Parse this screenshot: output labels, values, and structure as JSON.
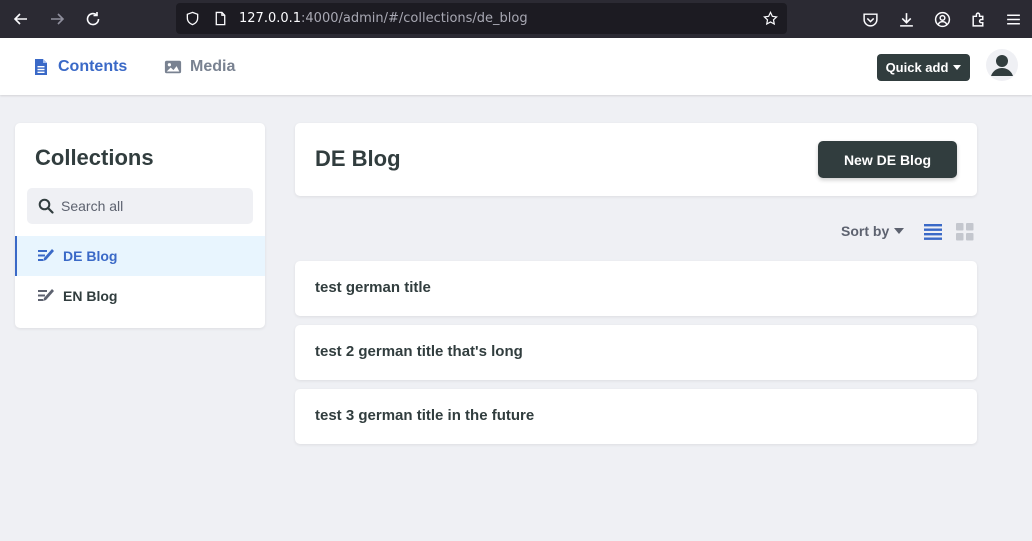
{
  "browser": {
    "url_host": "127.0.0.1",
    "url_rest": ":4000/admin/#/collections/de_blog",
    "icons": [
      "back-icon",
      "forward-icon",
      "reload-icon",
      "shield-icon",
      "page-icon",
      "bookmark-star-icon",
      "pocket-icon",
      "download-icon",
      "account-icon",
      "extensions-icon",
      "menu-icon"
    ]
  },
  "header": {
    "tabs": [
      {
        "label": "Contents",
        "icon": "document-icon",
        "active": true
      },
      {
        "label": "Media",
        "icon": "image-icon",
        "active": false
      }
    ],
    "quick_add_label": "Quick add"
  },
  "sidebar": {
    "title": "Collections",
    "search_placeholder": "Search all",
    "items": [
      {
        "label": "DE Blog",
        "icon": "edit-list-icon",
        "active": true
      },
      {
        "label": "EN Blog",
        "icon": "edit-list-icon",
        "active": false
      }
    ]
  },
  "main": {
    "title": "DE Blog",
    "new_button_label": "New DE Blog",
    "sort_label": "Sort by",
    "view_modes": [
      "list",
      "grid"
    ],
    "active_view": "list",
    "entries": [
      {
        "title": "test german title"
      },
      {
        "title": "test 2 german title that's long"
      },
      {
        "title": "test 3 german title in the future"
      }
    ]
  },
  "colors": {
    "accent": "#3a69c7",
    "dark": "#313d3e",
    "background": "#eff0f4",
    "active_item_bg": "#e8f5fe"
  }
}
